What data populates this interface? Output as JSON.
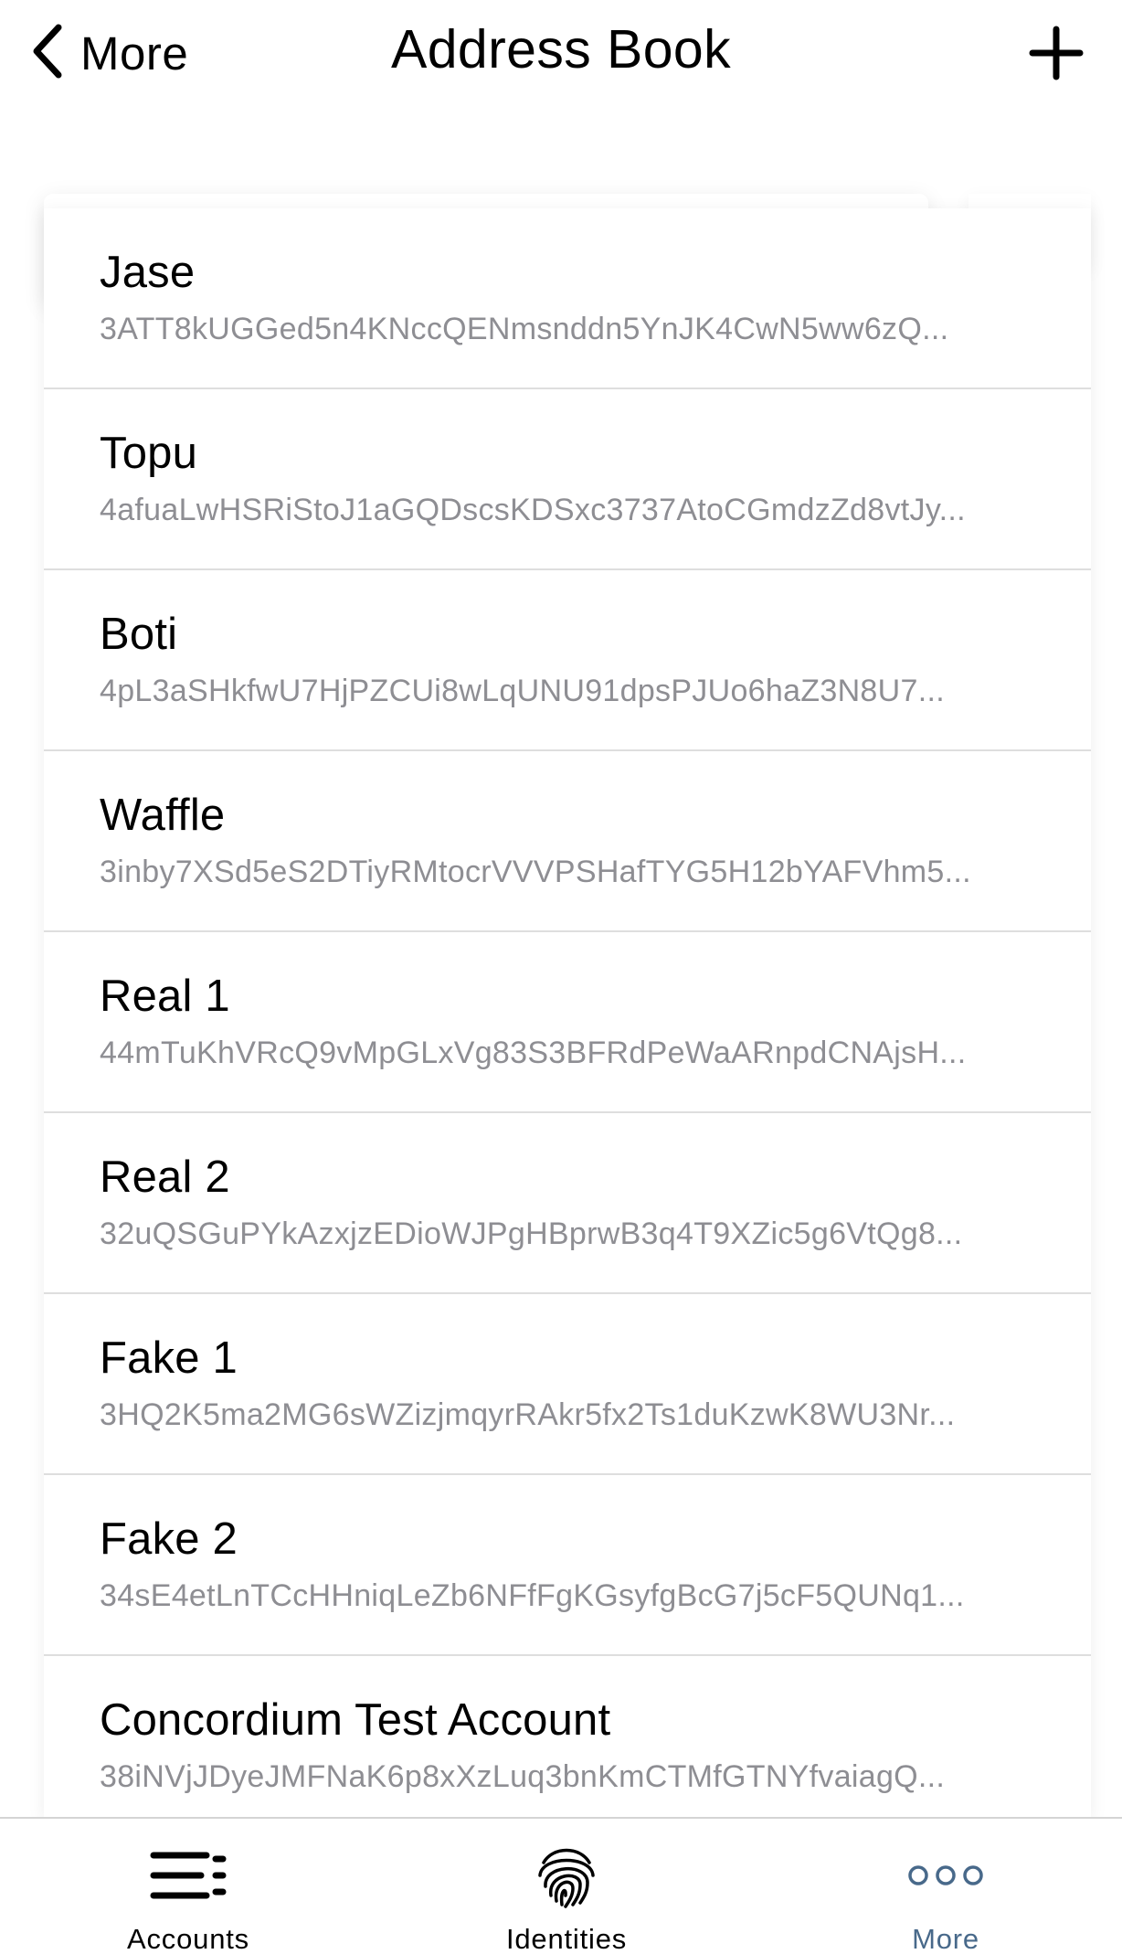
{
  "nav": {
    "back_label": "More",
    "title": "Address Book",
    "add_icon": "plus-icon",
    "back_icon": "chevron-left-icon"
  },
  "contacts": [
    {
      "name": "Jase",
      "address": "3ATT8kUGGed5n4KNccQENmsnddn5YnJK4CwN5ww6zQ..."
    },
    {
      "name": "Topu",
      "address": "4afuaLwHSRiStoJ1aGQDscsKDSxc3737AtoCGmdzZd8vtJy..."
    },
    {
      "name": "Boti",
      "address": "4pL3aSHkfwU7HjPZCUi8wLqUNU91dpsPJUo6haZ3N8U7..."
    },
    {
      "name": "Waffle",
      "address": "3inby7XSd5eS2DTiyRMtocrVVVPSHafTYG5H12bYAFVhm5..."
    },
    {
      "name": "Real 1",
      "address": "44mTuKhVRcQ9vMpGLxVg83S3BFRdPeWaARnpdCNAjsH..."
    },
    {
      "name": "Real 2",
      "address": "32uQSGuPYkAzxjzEDioWJPgHBprwB3q4T9XZic5g6VtQg8..."
    },
    {
      "name": "Fake 1",
      "address": "3HQ2K5ma2MG6sWZizjmqyrRAkr5fx2Ts1duKzwK8WU3Nr..."
    },
    {
      "name": "Fake 2",
      "address": "34sE4etLnTCcHHniqLeZb6NFfFgKGsyfgBcG7j5cF5QUNq1..."
    },
    {
      "name": "Concordium Test Account",
      "address": "38iNVjJDyeJMFNaK6p8xXzLuq3bnKmCTMfGTNYfvaiagQ..."
    }
  ],
  "tabbar": {
    "tabs": [
      {
        "label": "Accounts",
        "icon": "accounts-list-icon",
        "active": false
      },
      {
        "label": "Identities",
        "icon": "fingerprint-icon",
        "active": false
      },
      {
        "label": "More",
        "icon": "more-dots-icon",
        "active": true
      }
    ]
  },
  "colors": {
    "text_primary": "#000000",
    "text_secondary": "#8e8e93",
    "active_tab": "#48698a",
    "divider": "#dedede"
  }
}
